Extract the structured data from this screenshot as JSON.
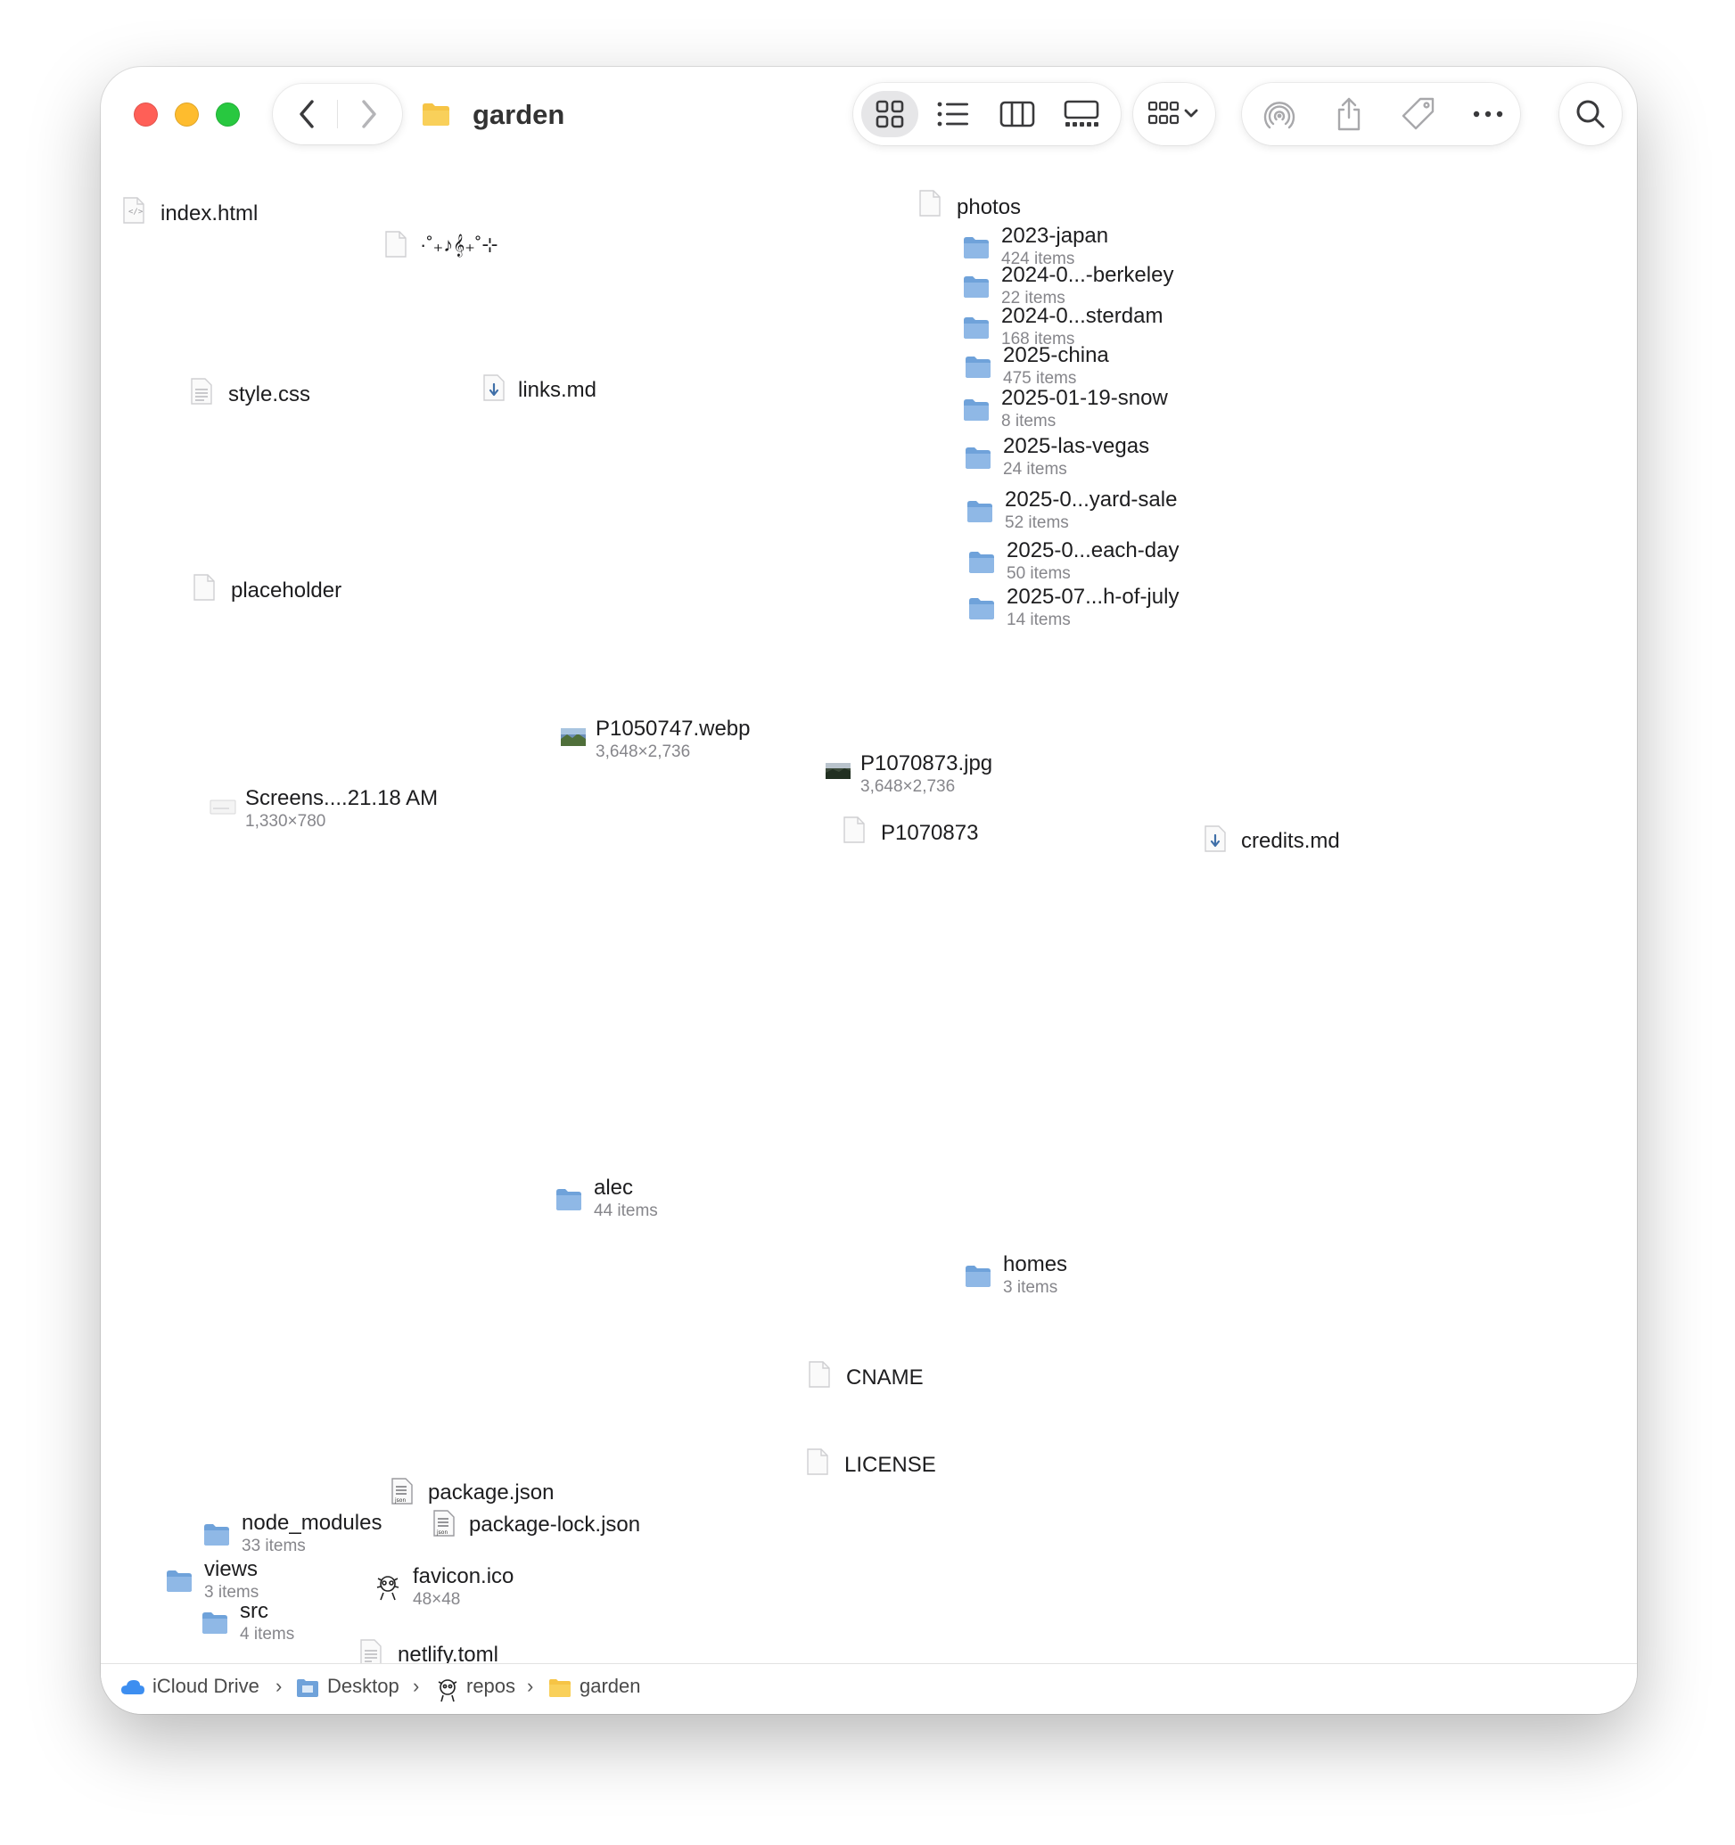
{
  "window": {
    "title": "garden"
  },
  "toolbar": {
    "back_icon": "chevron-left-icon",
    "forward_icon": "chevron-right-icon",
    "views": [
      "icon-view-icon",
      "list-view-icon",
      "column-view-icon",
      "gallery-view-icon"
    ],
    "group_icon": "group-by-icon",
    "airdrop_icon": "airdrop-icon",
    "share_icon": "share-icon",
    "tag_icon": "tag-icon",
    "more_icon": "ellipsis-icon",
    "search_icon": "search-icon"
  },
  "items": {
    "index_html": {
      "name": "index.html"
    },
    "sparkle": {
      "name": "·˚₊♪𝄞₊˚⊹"
    },
    "photos": {
      "name": "photos"
    },
    "style_css": {
      "name": "style.css"
    },
    "links_md": {
      "name": "links.md"
    },
    "placeholder": {
      "name": "placeholder"
    },
    "p1050747": {
      "name": "P1050747.webp",
      "sub": "3,648×2,736"
    },
    "screenshot": {
      "name": "Screens....21.18 AM",
      "sub": "1,330×780"
    },
    "p1070873_jpg": {
      "name": "P1070873.jpg",
      "sub": "3,648×2,736"
    },
    "p1070873": {
      "name": "P1070873"
    },
    "credits_md": {
      "name": "credits.md"
    },
    "alec": {
      "name": "alec",
      "sub": "44 items"
    },
    "homes": {
      "name": "homes",
      "sub": "3 items"
    },
    "cname": {
      "name": "CNAME"
    },
    "license": {
      "name": "LICENSE"
    },
    "package_json": {
      "name": "package.json"
    },
    "node_modules": {
      "name": "node_modules",
      "sub": "33 items"
    },
    "package_lock_json": {
      "name": "package-lock.json"
    },
    "views": {
      "name": "views",
      "sub": "3 items"
    },
    "favicon_ico": {
      "name": "favicon.ico",
      "sub": "48×48"
    },
    "src": {
      "name": "src",
      "sub": "4 items"
    },
    "netlify_toml": {
      "name": "netlify.toml"
    }
  },
  "photo_folders": [
    {
      "name": "2023-japan",
      "sub": "424 items"
    },
    {
      "name": "2024-0...-berkeley",
      "sub": "22 items"
    },
    {
      "name": "2024-0...sterdam",
      "sub": "168 items"
    },
    {
      "name": "2025-china",
      "sub": "475 items"
    },
    {
      "name": "2025-01-19-snow",
      "sub": "8 items"
    },
    {
      "name": "2025-las-vegas",
      "sub": "24 items"
    },
    {
      "name": "2025-0...yard-sale",
      "sub": "52 items"
    },
    {
      "name": "2025-0...each-day",
      "sub": "50 items"
    },
    {
      "name": "2025-07...h-of-july",
      "sub": "14 items"
    }
  ],
  "pathbar": {
    "crumbs": [
      "iCloud Drive",
      "Desktop",
      "repos",
      "garden"
    ],
    "separator": "›"
  },
  "colors": {
    "folder_blue": "#8fb8e6",
    "folder_yellow": "#f6c445",
    "close": "#ff5f57",
    "minimize": "#febc2e",
    "zoom": "#28c840"
  }
}
